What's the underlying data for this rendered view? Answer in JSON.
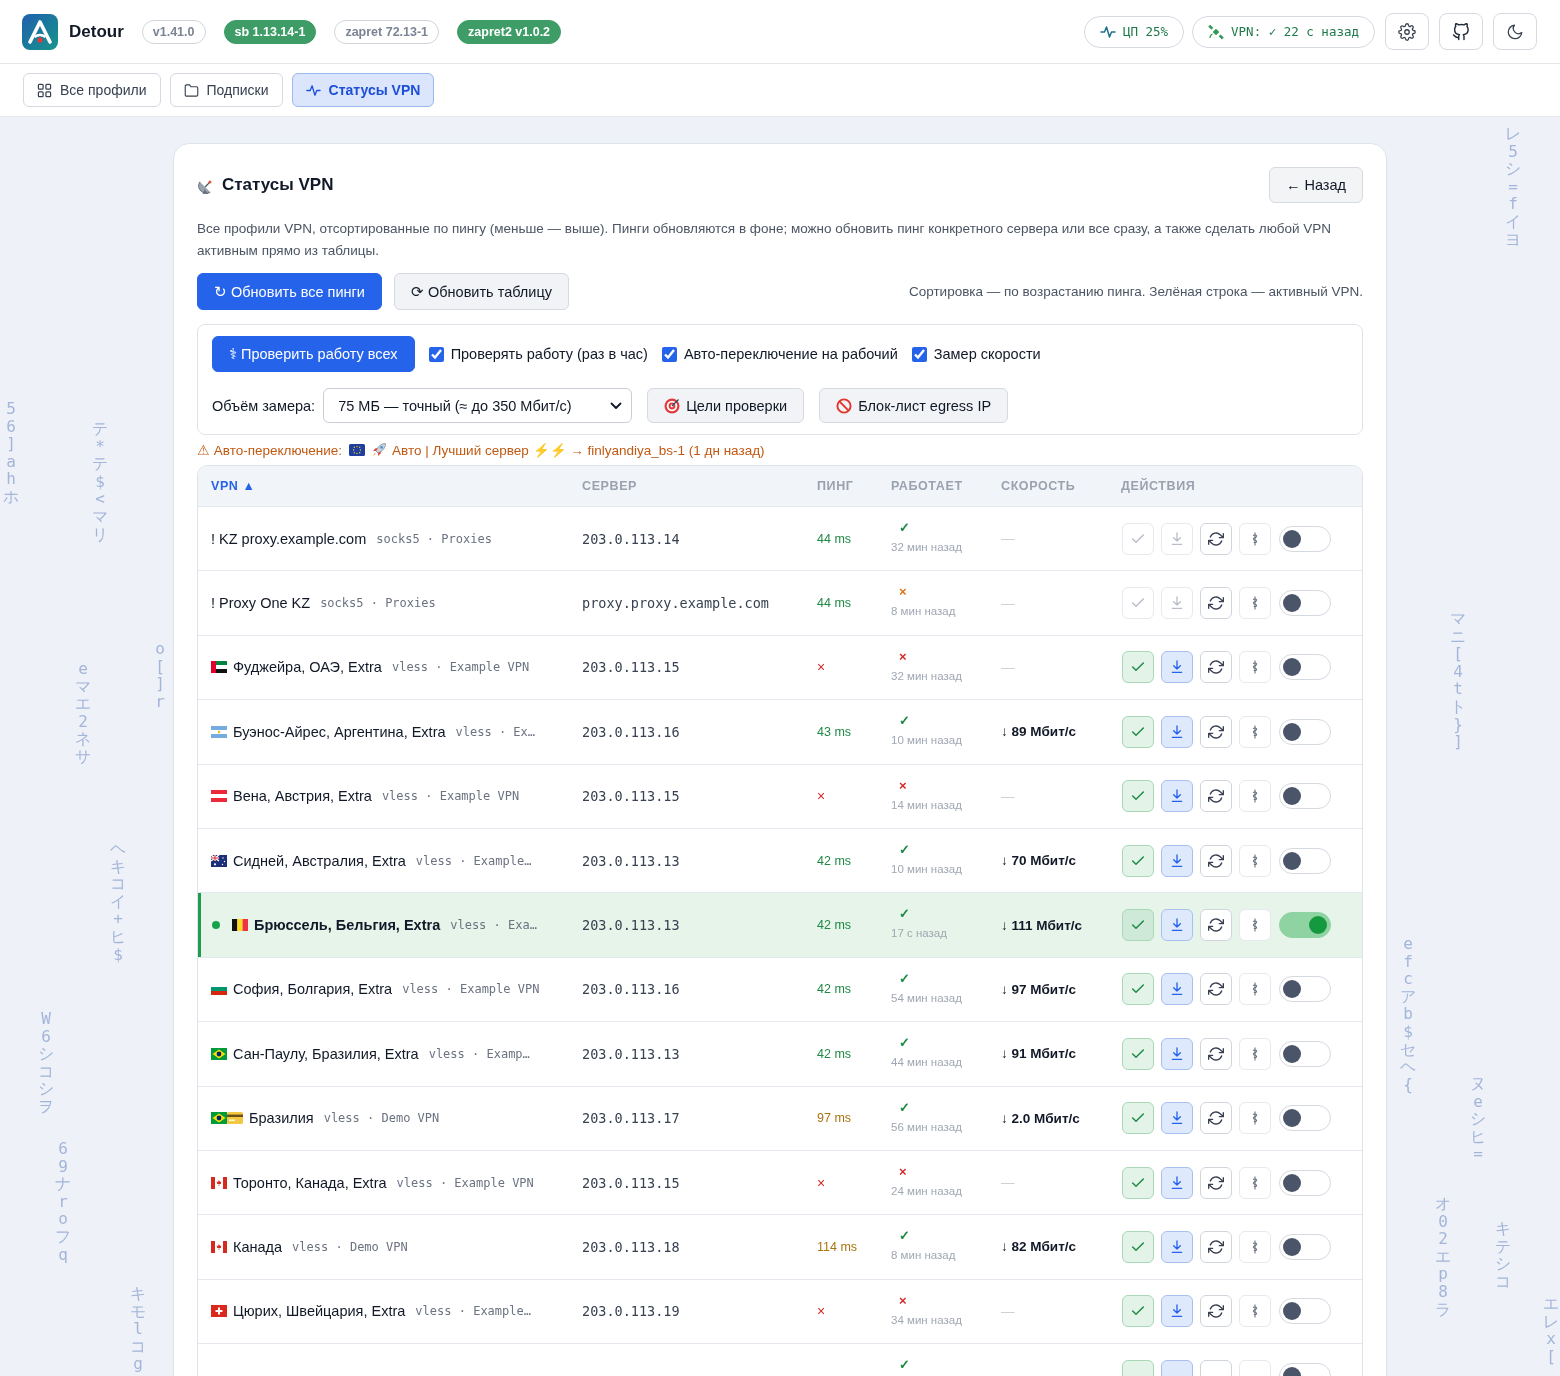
{
  "background_rain": [
    {
      "text": "56]ahホ"
    },
    {
      "text": "テ*テ$<マリ"
    },
    {
      "text": "o[]r"
    },
    {
      "text": "eマエ2ネサ"
    },
    {
      "text": "ヘキコイ+ヒ$"
    },
    {
      "text": "W6シコシヲ"
    },
    {
      "text": "69ナroフq"
    },
    {
      "text": "キモlコg"
    },
    {
      "text": "レ5シ=fイヨ"
    },
    {
      "text": "マニ[4tト}]"
    },
    {
      "text": "efcアb$セヘ{"
    },
    {
      "text": "ヌeシヒ="
    },
    {
      "text": "オ02エp8ラ"
    },
    {
      "text": "キテシコ"
    },
    {
      "text": "エレx["
    }
  ],
  "header": {
    "app_name": "Detour",
    "badges": [
      {
        "text": "v1.41.0",
        "kind": "plain"
      },
      {
        "text": "sb 1.13.14-1",
        "kind": "ok"
      },
      {
        "text": "zapret 72.13-1",
        "kind": "plain"
      },
      {
        "text": "zapret2 v1.0.2",
        "kind": "ok"
      }
    ],
    "cpu": "ЦП 25%",
    "vpn_status": "VPN: ✓ 22 с назад"
  },
  "nav": {
    "tabs": [
      {
        "label": "Все профили",
        "selected": false
      },
      {
        "label": "Подписки",
        "selected": false
      },
      {
        "label": "Статусы VPN",
        "selected": true
      }
    ]
  },
  "card": {
    "title": "Статусы VPN",
    "back": "← Назад",
    "description": "Все профили VPN, отсортированные по пингу (меньше — выше). Пинги обновляются в фоне; можно обновить пинг конкретного сервера или все сразу, а также сделать любой VPN активным прямо из таблицы.",
    "buttons": [
      {
        "label": "↻ Обновить все пинги",
        "kind": "primary"
      },
      {
        "label": "⟳ Обновить таблицу",
        "kind": "secondary"
      }
    ],
    "sort_note": "Сортировка — по возрастанию пинга. Зелёная строка — активный VPN."
  },
  "check_panel": {
    "run_all": "⚕ Проверить работу всех",
    "options": [
      {
        "label": "Проверять работу (раз в час)",
        "checked": true
      },
      {
        "label": "Авто-переключение на рабочий",
        "checked": true
      },
      {
        "label": "Замер скорости",
        "checked": true
      }
    ],
    "volume_label": "Объём замера:",
    "volume_value": "75 МБ — точный (≈ до 350 Мбит/с)",
    "buttons": [
      {
        "label": "Цели проверки"
      },
      {
        "label": "Блок-лист egress IP"
      }
    ]
  },
  "autoswitch": {
    "label": "⚠ Авто-переключение:",
    "text": "Авто | Лучший сервер ⚡⚡ → finlyandiya_bs-1 (1 дн назад)"
  },
  "table": {
    "columns": [
      {
        "label": "VPN ▲",
        "sorted": true
      },
      {
        "label": "СЕРВЕР",
        "sorted": false
      },
      {
        "label": "ПИНГ",
        "sorted": false
      },
      {
        "label": "РАБОТАЕТ",
        "sorted": false
      },
      {
        "label": "СКОРОСТЬ",
        "sorted": false
      },
      {
        "label": "ДЕЙСТВИЯ",
        "sorted": false
      }
    ],
    "rows": [
      {
        "name": "! KZ proxy.example.com",
        "proto": "socks5 · Proxies",
        "server": "203.0.113.14",
        "ping": {
          "text": "44 ms",
          "kind": "good"
        },
        "works": {
          "mark": "✓",
          "kind": "ok",
          "time": "32 мин назад"
        },
        "speed": {
          "text": "—",
          "measured": false
        },
        "tools_enabled": false,
        "active": false,
        "on": false
      },
      {
        "name": "! Proxy One KZ",
        "proto": "socks5 · Proxies",
        "server": "proxy.proxy.example.com",
        "ping": {
          "text": "44 ms",
          "kind": "good"
        },
        "works": {
          "mark": "×",
          "kind": "warn",
          "time": "8 мин назад"
        },
        "speed": {
          "text": "—",
          "measured": false
        },
        "tools_enabled": false,
        "active": false,
        "on": false
      },
      {
        "icons": [
          {
            "kind": "flag_ae"
          }
        ],
        "name": "Фуджейра, ОАЭ, Extra",
        "proto": "vless · Example VPN",
        "server": "203.0.113.15",
        "ping": {
          "text": "×",
          "kind": "fail"
        },
        "works": {
          "mark": "×",
          "kind": "fail",
          "time": "32 мин назад"
        },
        "speed": {
          "text": "—",
          "measured": false
        },
        "tools_enabled": true,
        "active": false,
        "on": false
      },
      {
        "icons": [
          {
            "kind": "flag_ar"
          }
        ],
        "name": "Буэнос-Айрес, Аргентина, Extra",
        "proto": "vless · Ex…",
        "server": "203.0.113.16",
        "ping": {
          "text": "43 ms",
          "kind": "good"
        },
        "works": {
          "mark": "✓",
          "kind": "ok",
          "time": "10 мин назад"
        },
        "speed": {
          "text": "↓ 89 Мбит/с",
          "measured": true
        },
        "tools_enabled": true,
        "active": false,
        "on": false
      },
      {
        "icons": [
          {
            "kind": "flag_at"
          }
        ],
        "name": "Вена, Австрия, Extra",
        "proto": "vless · Example VPN",
        "server": "203.0.113.15",
        "ping": {
          "text": "×",
          "kind": "fail"
        },
        "works": {
          "mark": "×",
          "kind": "fail",
          "time": "14 мин назад"
        },
        "speed": {
          "text": "—",
          "measured": false
        },
        "tools_enabled": true,
        "active": false,
        "on": false
      },
      {
        "icons": [
          {
            "kind": "flag_au"
          }
        ],
        "name": "Сидней, Австралия, Extra",
        "proto": "vless · Example…",
        "server": "203.0.113.13",
        "ping": {
          "text": "42 ms",
          "kind": "good"
        },
        "works": {
          "mark": "✓",
          "kind": "ok",
          "time": "10 мин назад"
        },
        "speed": {
          "text": "↓ 70 Мбит/с",
          "measured": true
        },
        "tools_enabled": true,
        "active": false,
        "on": false
      },
      {
        "icons": [
          {
            "kind": "flag_be"
          }
        ],
        "name": "Брюссель, Бельгия, Extra",
        "proto": "vless · Exa…",
        "server": "203.0.113.13",
        "ping": {
          "text": "42 ms",
          "kind": "good"
        },
        "works": {
          "mark": "✓",
          "kind": "ok",
          "time": "17 с назад"
        },
        "speed": {
          "text": "↓ 111 Мбит/с",
          "measured": true
        },
        "tools_enabled": true,
        "active": true,
        "on": true
      },
      {
        "icons": [
          {
            "kind": "flag_bg"
          }
        ],
        "name": "София, Болгария, Extra",
        "proto": "vless · Example VPN",
        "server": "203.0.113.16",
        "ping": {
          "text": "42 ms",
          "kind": "good"
        },
        "works": {
          "mark": "✓",
          "kind": "ok",
          "time": "54 мин назад"
        },
        "speed": {
          "text": "↓ 97 Мбит/с",
          "measured": true
        },
        "tools_enabled": true,
        "active": false,
        "on": false
      },
      {
        "icons": [
          {
            "kind": "flag_br"
          }
        ],
        "name": "Сан-Паулу, Бразилия, Extra",
        "proto": "vless · Examp…",
        "server": "203.0.113.13",
        "ping": {
          "text": "42 ms",
          "kind": "good"
        },
        "works": {
          "mark": "✓",
          "kind": "ok",
          "time": "44 мин назад"
        },
        "speed": {
          "text": "↓ 91 Мбит/с",
          "measured": true
        },
        "tools_enabled": true,
        "active": false,
        "on": false
      },
      {
        "icons": [
          {
            "kind": "flag_br"
          },
          {
            "kind": "card"
          }
        ],
        "name": "Бразилия",
        "proto": "vless · Demo VPN",
        "server": "203.0.113.17",
        "ping": {
          "text": "97 ms",
          "kind": "slow"
        },
        "works": {
          "mark": "✓",
          "kind": "ok",
          "time": "56 мин назад"
        },
        "speed": {
          "text": "↓ 2.0 Мбит/с",
          "measured": true
        },
        "tools_enabled": true,
        "active": false,
        "on": false
      },
      {
        "icons": [
          {
            "kind": "flag_ca"
          }
        ],
        "name": "Торонто, Канада, Extra",
        "proto": "vless · Example VPN",
        "server": "203.0.113.15",
        "ping": {
          "text": "×",
          "kind": "fail"
        },
        "works": {
          "mark": "×",
          "kind": "fail",
          "time": "24 мин назад"
        },
        "speed": {
          "text": "—",
          "measured": false
        },
        "tools_enabled": true,
        "active": false,
        "on": false
      },
      {
        "icons": [
          {
            "kind": "flag_ca"
          }
        ],
        "name": "Канада",
        "proto": "vless · Demo VPN",
        "server": "203.0.113.18",
        "ping": {
          "text": "114 ms",
          "kind": "slow"
        },
        "works": {
          "mark": "✓",
          "kind": "ok",
          "time": "8 мин назад"
        },
        "speed": {
          "text": "↓ 82 Мбит/с",
          "measured": true
        },
        "tools_enabled": true,
        "active": false,
        "on": false
      },
      {
        "icons": [
          {
            "kind": "flag_ch"
          }
        ],
        "name": "Цюрих, Швейцария, Extra",
        "proto": "vless · Example…",
        "server": "203.0.113.19",
        "ping": {
          "text": "×",
          "kind": "fail"
        },
        "works": {
          "mark": "×",
          "kind": "fail",
          "time": "34 мин назад"
        },
        "speed": {
          "text": "—",
          "measured": false
        },
        "tools_enabled": true,
        "active": false,
        "on": false
      },
      {
        "works": {
          "mark": "✓",
          "kind": "ok"
        },
        "tools_enabled": true,
        "active": false,
        "on": false
      }
    ]
  }
}
